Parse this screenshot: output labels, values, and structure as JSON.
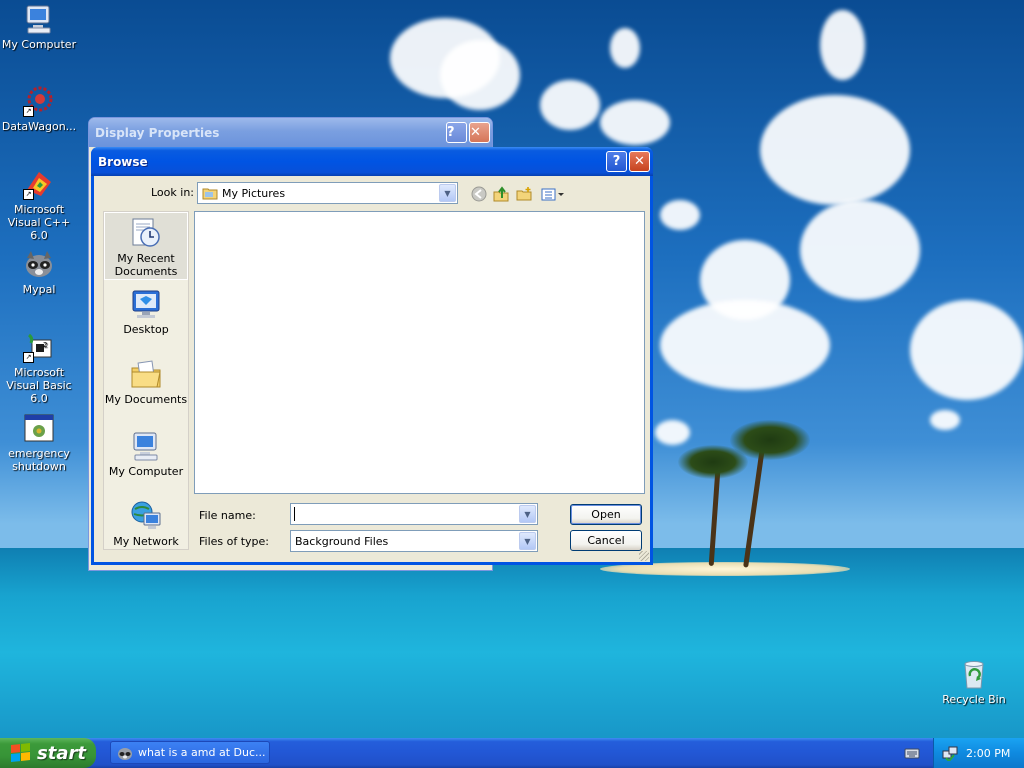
{
  "desktop": {
    "icons": [
      {
        "label": "My Computer"
      },
      {
        "label": "DataWagon..."
      },
      {
        "label": "Microsoft Visual C++ 6.0"
      },
      {
        "label": "Mypal"
      },
      {
        "label": "Microsoft Visual Basic 6.0"
      },
      {
        "label": "emergency shutdown"
      },
      {
        "label": "Recycle Bin"
      }
    ]
  },
  "display_properties": {
    "title": "Display Properties",
    "help_glyph": "?",
    "close_glyph": "✕"
  },
  "browse": {
    "title": "Browse",
    "help_glyph": "?",
    "close_glyph": "✕",
    "look_in_label": "Look in:",
    "look_in_value": "My Pictures",
    "places": [
      {
        "label": "My Recent Documents",
        "icon": "recent-documents-icon"
      },
      {
        "label": "Desktop",
        "icon": "desktop-icon"
      },
      {
        "label": "My Documents",
        "icon": "my-documents-icon"
      },
      {
        "label": "My Computer",
        "icon": "my-computer-icon"
      },
      {
        "label": "My Network",
        "icon": "my-network-icon"
      }
    ],
    "file_name_label": "File name:",
    "file_name_value": "",
    "files_of_type_label": "Files of type:",
    "files_of_type_value": "Background Files",
    "open_label": "Open",
    "cancel_label": "Cancel"
  },
  "taskbar": {
    "start_label": "start",
    "task_label": "what is a amd at Duc...",
    "clock": "2:00 PM"
  }
}
